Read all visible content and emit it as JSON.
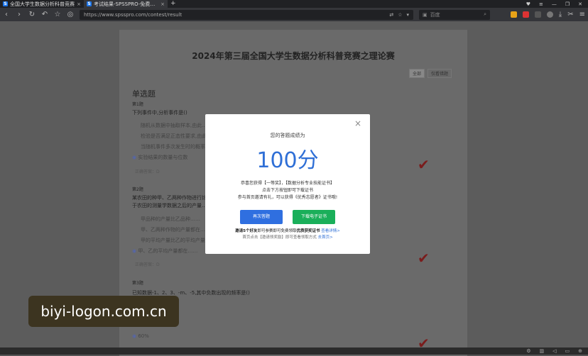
{
  "browser": {
    "tabs": [
      {
        "title": "全国大学生数据分析科普竞赛",
        "active": false
      },
      {
        "title": "考试结果-SPSSPRO-免费专业",
        "active": true
      }
    ],
    "new_tab": "+",
    "url": "https://www.spsspro.com/contest/result",
    "search_placeholder": "百度"
  },
  "page": {
    "title": "2024年第三届全国大学生数据分析科普竞赛之理论赛",
    "toggles": [
      "全部",
      "仅看错题"
    ],
    "section": "单选题",
    "questions": [
      {
        "label": "第1题",
        "text": "下列事件中,分析事件是()",
        "options": [
          "随机从数据中抽取样本,由此...",
          "检验是否满足正态性要求,由此...",
          "当随机事件多次发生时的概率规律...",
          "实验结果的数量与位数"
        ],
        "selected": "实验结果的数量与位数",
        "answer": "正确答案：D"
      },
      {
        "label": "第2题",
        "text": "某农田的种甲、乙两种作物进行比较……",
        "text2": "于农田的测量学数据之后的产量……",
        "options": [
          "甲品种的产量比乙品种……",
          "甲、乙两种作物的产量都在……",
          "甲的平均产量比乙的平均产量……"
        ],
        "selected": "甲、乙的平均产量都在……",
        "answer": "正确答案：D"
      },
      {
        "label": "第3题",
        "text": "已知数据-1、2、3、-m、-5,其中负数出现的频率是()",
        "selected": "60%"
      }
    ]
  },
  "modal": {
    "close": "×",
    "hint": "您的答题成绩为",
    "score": "100分",
    "line1": "恭喜您获得【一等奖】，【数据分析专业技能证书】",
    "line2": "点击下方按钮即可下载证书",
    "line3": "参与首页邀请有礼，可以获得《优秀志愿者》证书哦!",
    "btn_retry": "再次答题",
    "btn_download": "下载电子证书",
    "invite_prefix": "邀请5个好友",
    "invite_mid": "即可参赛即可免费领取",
    "invite_bold": "优质获奖证书",
    "invite_link": "查看详情>",
    "note": "首页点击【邀请领奖励】即可查看领取方式",
    "note_link": "去首页>"
  },
  "watermark": "biyi-logon.com.cn",
  "colors": {
    "score": "#2f6fd6",
    "retry": "#2f6fe0",
    "download": "#1aaf5a",
    "check": "#7a1c1c"
  }
}
